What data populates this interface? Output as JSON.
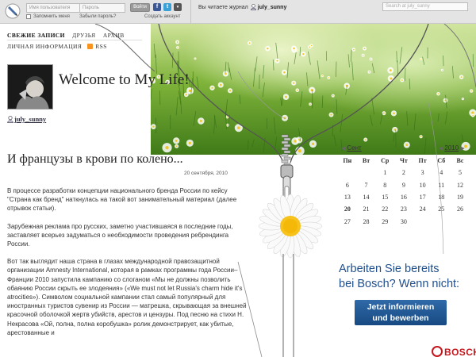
{
  "topbar": {
    "username_placeholder": "Имя пользователя",
    "password_placeholder": "Пароль",
    "login_label": "Войти",
    "remember_label": "Запомнить меня",
    "forgot_label": "Забыли пароль?",
    "create_label": "Создать аккаунт",
    "reading_label": "Вы читаете журнал",
    "journal_user": "july_sunny",
    "search_placeholder": "Search at july_sunny",
    "social": [
      "f",
      "t",
      "▾"
    ]
  },
  "nav": {
    "items": [
      "СВЕЖИЕ ЗАПИСИ",
      "ДРУЗЬЯ",
      "АРХИВ"
    ],
    "items2": [
      "ЛИЧНАЯ ИНФОРМАЦИЯ",
      "RSS"
    ]
  },
  "site": {
    "title": "Welcome to My Life!",
    "owner": "july_sunny"
  },
  "post": {
    "title": "И французы в крови по колено...",
    "date": "20 сентября, 2010",
    "paragraphs": [
      "В процессе разработки концепции национального бренда России по кейсу \"Страна как бренд\" наткнулась на такой вот занимательный материал (далее отрывок статьи).",
      "Зарубежная реклама про русских, заметно участившаяся в последние годы, заставляет всерьез задуматься о необходимости проведения ребрендинга России.",
      "Вот так выглядит наша страна в глазах международной правозащитной организации Amnesty International, которая в рамках программы года России–Франции 2010 запустила кампанию со слоганом «Мы не должны позволить обаянию России скрыть ее злодеяния» («We must not let Russia's charm hide it's atrocities»). Символом социальной кампании стал самый популярный для иностранных туристов сувенир из России — матрешка, скрывающая за внешней красочной оболочкой жертв убийств, арестов и цензуры. Под песню на стихи Н. Некрасова «Ой, полна, полна коробушка» ролик демонстрирует, как убитые, арестованные и"
    ]
  },
  "calendar": {
    "prev_month": "Сент",
    "year": "2010",
    "days_of_week": [
      "Пн",
      "Вт",
      "Ср",
      "Чт",
      "Пт",
      "Сб",
      "Вс"
    ],
    "weeks": [
      [
        "",
        "",
        "1",
        "2",
        "3",
        "4",
        "5"
      ],
      [
        "6",
        "7",
        "8",
        "9",
        "10",
        "11",
        "12"
      ],
      [
        "13",
        "14",
        "15",
        "16",
        "17",
        "18",
        "19"
      ],
      [
        "20",
        "21",
        "22",
        "23",
        "24",
        "25",
        "26"
      ],
      [
        "27",
        "28",
        "29",
        "30",
        "",
        "",
        ""
      ]
    ],
    "bold_day": "20"
  },
  "ad": {
    "line1": "Arbeiten Sie bereits",
    "line2": "bei Bosch? Wenn nicht:",
    "button_line1": "Jetzt informieren",
    "button_line2": "und bewerben",
    "brand": "BOSCH",
    "brand_color": "#c4161c",
    "text_color": "#1f4e8c"
  }
}
